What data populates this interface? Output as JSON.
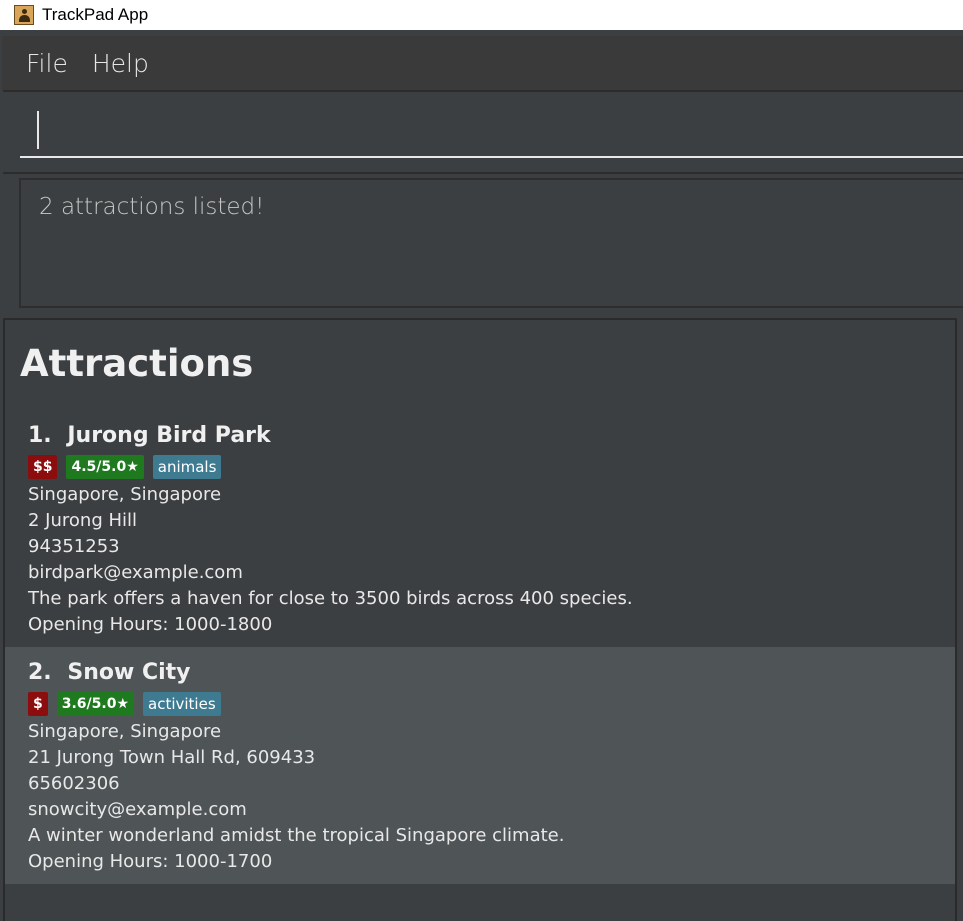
{
  "window": {
    "title": "TrackPad App",
    "icon": "contact-book-icon"
  },
  "menu": {
    "items": [
      "File",
      "Help"
    ]
  },
  "command": {
    "value": ""
  },
  "result": {
    "text": "2 attractions listed!"
  },
  "attractions": {
    "header": "Attractions",
    "items": [
      {
        "index": "1.",
        "name": "Jurong Bird Park",
        "price": "$$",
        "rating": "4.5/5.0★",
        "tag": "animals",
        "location": "Singapore, Singapore",
        "address": "2 Jurong Hill",
        "phone": "94351253",
        "email": "birdpark@example.com",
        "description": "The park offers a haven for close to 3500 birds across 400 species.",
        "hours": "Opening Hours: 1000-1800"
      },
      {
        "index": "2.",
        "name": "Snow City",
        "price": "$",
        "rating": "3.6/5.0★",
        "tag": "activities",
        "location": "Singapore, Singapore",
        "address": "21 Jurong Town Hall Rd, 609433",
        "phone": "65602306",
        "email": "snowcity@example.com",
        "description": "A winter wonderland amidst the tropical Singapore climate.",
        "hours": "Opening Hours: 1000-1700"
      }
    ]
  },
  "colors": {
    "background": "#3c3f41",
    "selected_card": "#4f5457",
    "price_badge": "#8b0d0d",
    "rating_badge": "#1f7a1f",
    "tag_badge": "#3e7b91"
  }
}
